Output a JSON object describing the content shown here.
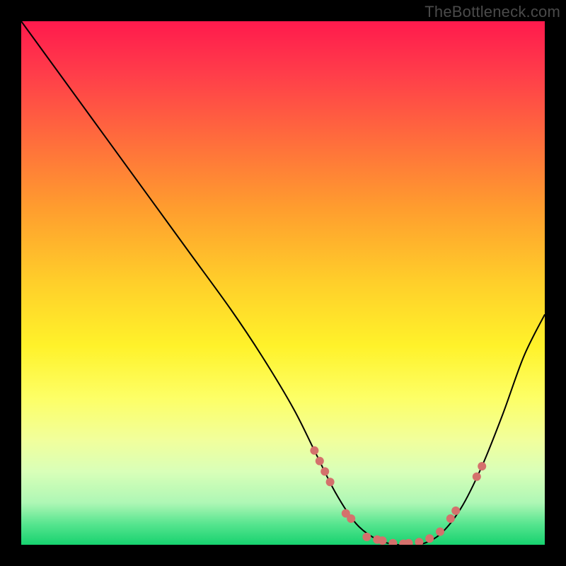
{
  "watermark": "TheBottleneck.com",
  "chart_data": {
    "type": "line",
    "title": "",
    "xlabel": "",
    "ylabel": "",
    "xlim": [
      0,
      100
    ],
    "ylim": [
      0,
      100
    ],
    "series": [
      {
        "name": "bottleneck-curve",
        "x": [
          0,
          8,
          16,
          24,
          32,
          40,
          46,
          52,
          56,
          60,
          64,
          68,
          72,
          76,
          80,
          84,
          88,
          92,
          96,
          100
        ],
        "values": [
          100,
          89,
          78,
          67,
          56,
          45,
          36,
          26,
          18,
          10,
          4,
          1,
          0,
          0,
          2,
          7,
          15,
          25,
          36,
          44
        ]
      }
    ],
    "markers": [
      {
        "x": 56,
        "y": 18
      },
      {
        "x": 57,
        "y": 16
      },
      {
        "x": 58,
        "y": 14
      },
      {
        "x": 59,
        "y": 12
      },
      {
        "x": 62,
        "y": 6
      },
      {
        "x": 63,
        "y": 5
      },
      {
        "x": 66,
        "y": 1.5
      },
      {
        "x": 68,
        "y": 1
      },
      {
        "x": 69,
        "y": 0.8
      },
      {
        "x": 71,
        "y": 0.3
      },
      {
        "x": 73,
        "y": 0.2
      },
      {
        "x": 74,
        "y": 0.3
      },
      {
        "x": 76,
        "y": 0.5
      },
      {
        "x": 78,
        "y": 1.2
      },
      {
        "x": 80,
        "y": 2.5
      },
      {
        "x": 82,
        "y": 5
      },
      {
        "x": 83,
        "y": 6.5
      },
      {
        "x": 87,
        "y": 13
      },
      {
        "x": 88,
        "y": 15
      }
    ],
    "gradient_stops": [
      {
        "pct": 0,
        "color": "#ff1a4d"
      },
      {
        "pct": 50,
        "color": "#ffcf2a"
      },
      {
        "pct": 72,
        "color": "#fdff66"
      },
      {
        "pct": 100,
        "color": "#17d26f"
      }
    ]
  }
}
